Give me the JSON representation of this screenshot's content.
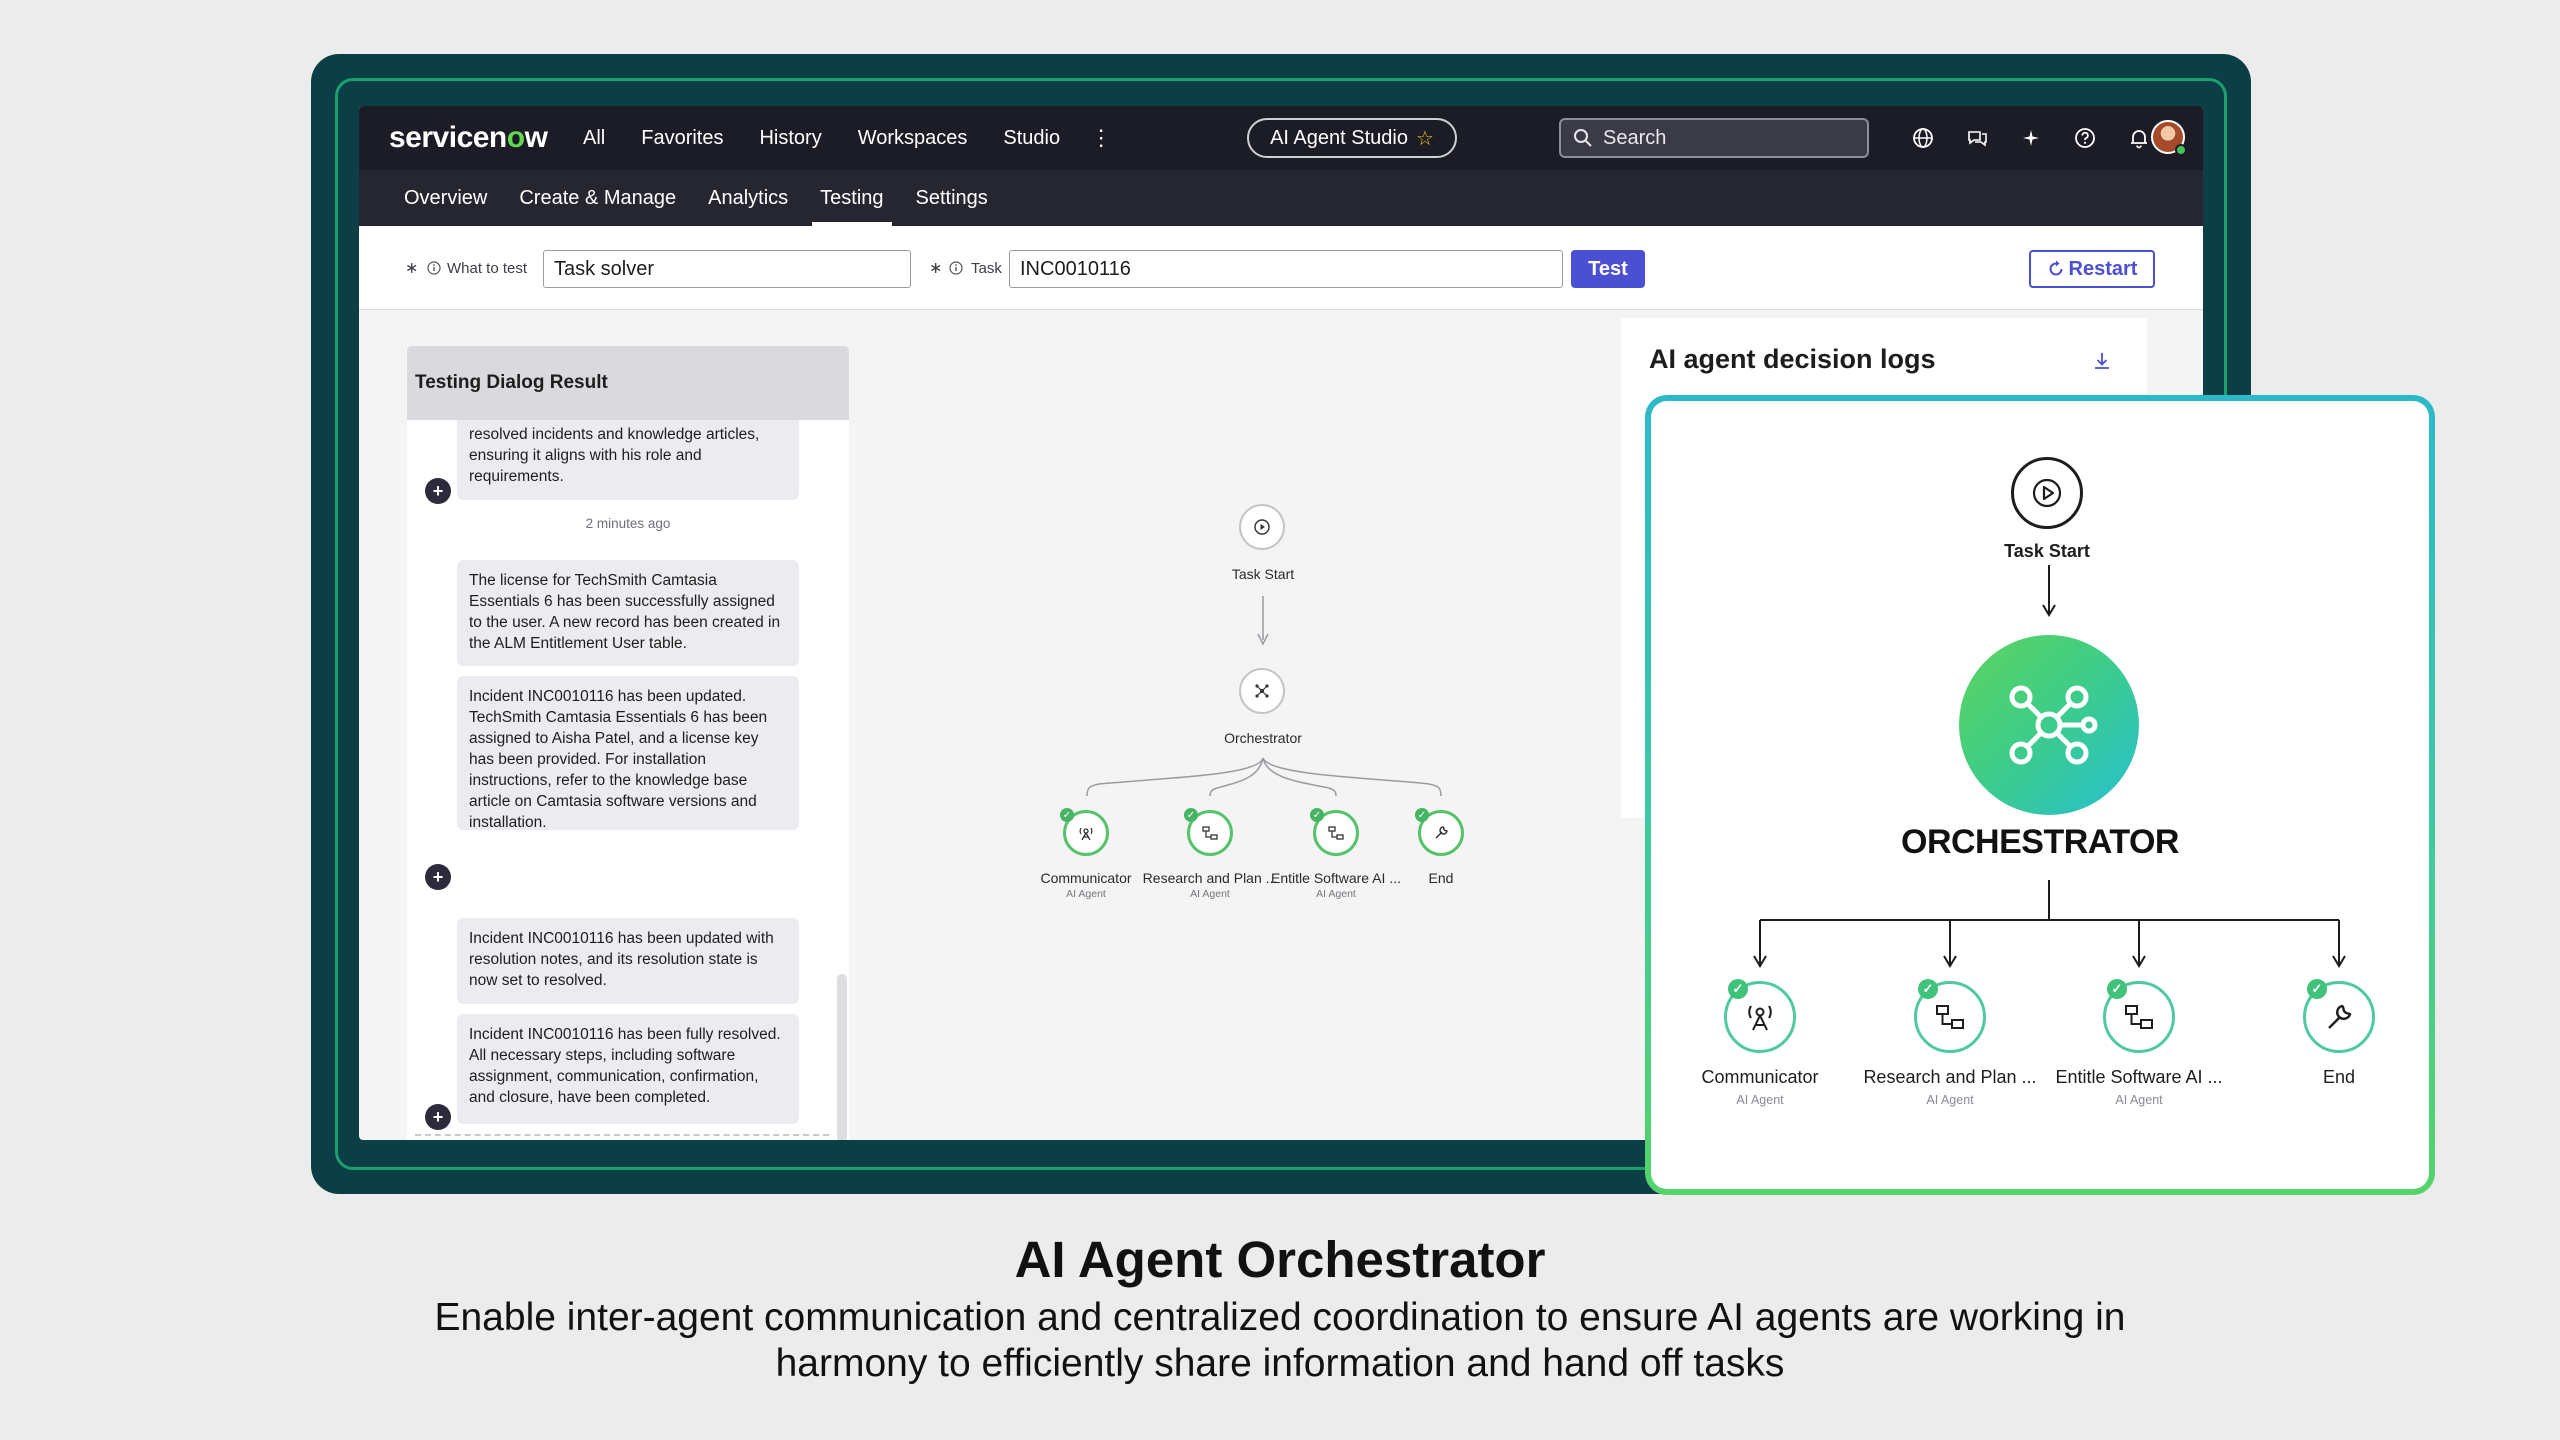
{
  "topnav": {
    "logo_prefix": "servicen",
    "logo_o": "o",
    "logo_suffix": "w",
    "links": [
      "All",
      "Favorites",
      "History",
      "Workspaces",
      "Studio"
    ],
    "studio_pill": "AI Agent Studio",
    "search_placeholder": "Search"
  },
  "subnav": {
    "tabs": [
      "Overview",
      "Create & Manage",
      "Analytics",
      "Testing",
      "Settings"
    ],
    "active": "Testing"
  },
  "toolbar": {
    "what_to_test_label": "What to test",
    "what_to_test_value": "Task solver",
    "task_label": "Task",
    "task_value": "INC0010116",
    "test_button": "Test",
    "restart_button": "Restart",
    "required_mark": "∗"
  },
  "chat": {
    "header": "Testing Dialog Result",
    "messages": [
      "resolved incidents and knowledge articles, ensuring it aligns with his role and requirements.",
      "The license for TechSmith Camtasia Essentials 6 has been successfully assigned to the user. A new record has been created in the ALM Entitlement User table.",
      "Incident INC0010116 has been updated. TechSmith Camtasia Essentials 6 has been assigned to Aisha Patel, and a license key has been provided. For installation instructions, refer to the knowledge base article on Camtasia software versions and installation.",
      "Incident INC0010116 has been updated with resolution notes, and its resolution state is now set to resolved.",
      "Incident INC0010116 has been fully resolved. All necessary steps, including software assignment, communication, confirmation, and closure, have been completed."
    ],
    "timestamp": "2 minutes ago"
  },
  "flow": {
    "start": "Task Start",
    "orchestrator": "Orchestrator",
    "orchestrator_caps": "ORCHESTRATOR",
    "children": [
      {
        "label": "Communicator",
        "sub": "AI Agent",
        "icon": "antenna-icon"
      },
      {
        "label": "Research and Plan ...",
        "sub": "AI Agent",
        "icon": "flowchart-icon"
      },
      {
        "label": "Entitle Software AI ...",
        "sub": "AI Agent",
        "icon": "flowchart-icon"
      },
      {
        "label": "End",
        "sub": "",
        "icon": "wrench-icon"
      }
    ]
  },
  "logs": {
    "title": "AI agent decision logs"
  },
  "caption": {
    "title": "AI Agent Orchestrator",
    "subtitle_line1": "Enable inter-agent communication and centralized coordination to ensure AI agents are working in",
    "subtitle_line2": "harmony to efficiently share information and hand off tasks"
  },
  "colors": {
    "accent": "#4b4fd1",
    "nav_bg": "#1c1c26",
    "device_frame": "#0c3f45",
    "success_green": "#46b463"
  }
}
